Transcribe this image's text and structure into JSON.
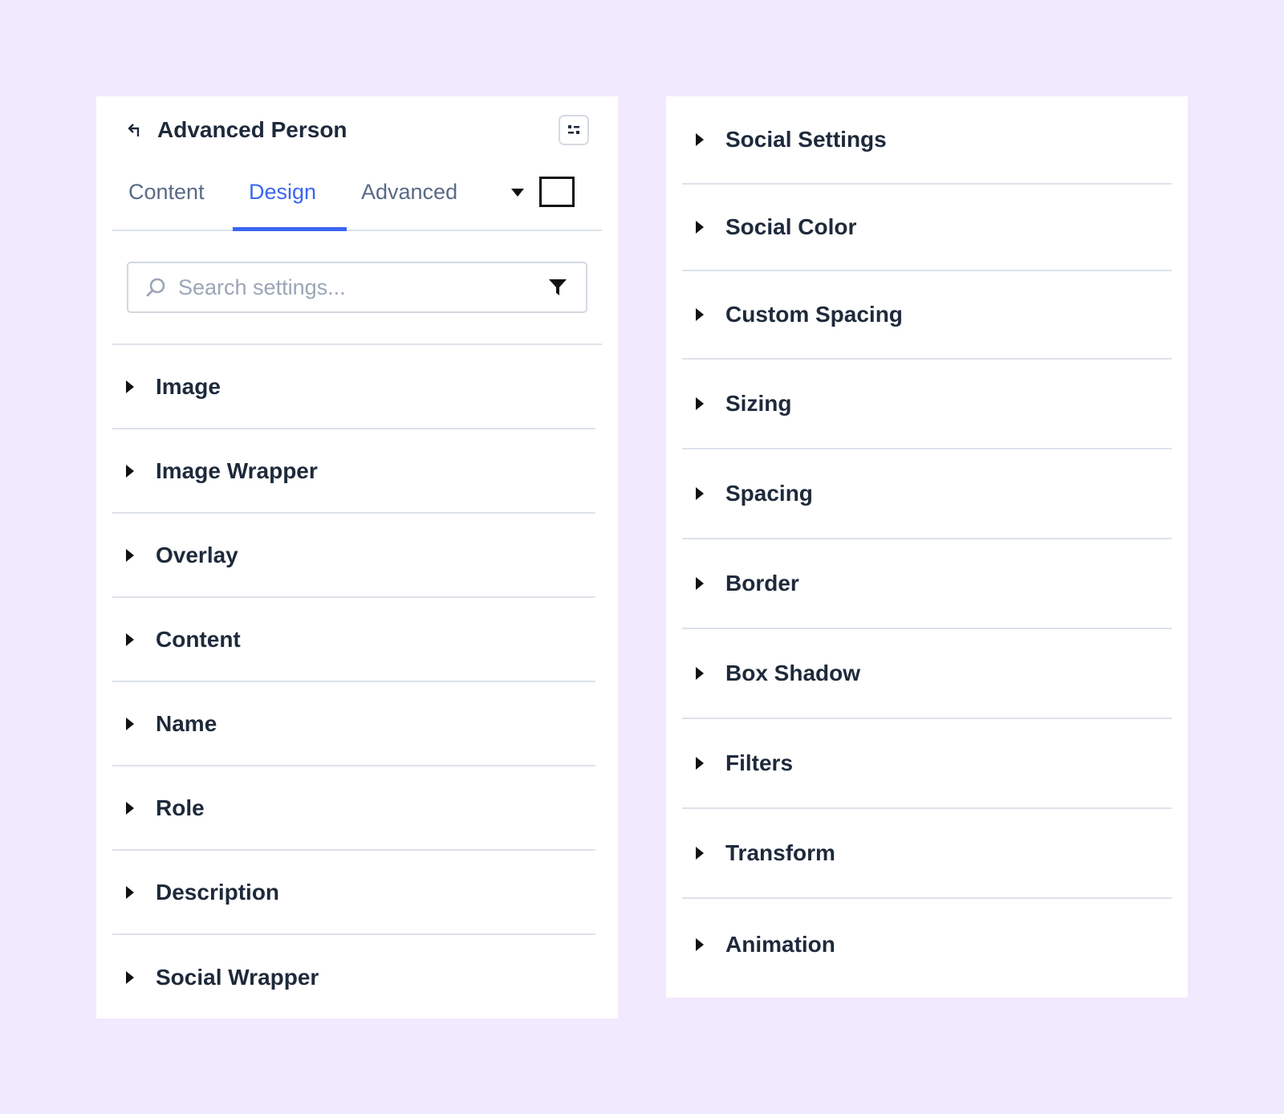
{
  "header": {
    "title": "Advanced Person",
    "back_icon": "back-arrow-icon",
    "collapse_icon": "collapse-panel-icon"
  },
  "tabs": [
    {
      "label": "Content",
      "active": false
    },
    {
      "label": "Design",
      "active": true
    },
    {
      "label": "Advanced",
      "active": false
    }
  ],
  "search": {
    "placeholder": "Search settings...",
    "value": ""
  },
  "left_sections": [
    {
      "label": "Image"
    },
    {
      "label": "Image Wrapper"
    },
    {
      "label": "Overlay"
    },
    {
      "label": "Content"
    },
    {
      "label": "Name"
    },
    {
      "label": "Role"
    },
    {
      "label": "Description"
    },
    {
      "label": "Social Wrapper"
    }
  ],
  "right_sections": [
    {
      "label": "Social Settings"
    },
    {
      "label": "Social Color"
    },
    {
      "label": "Custom Spacing"
    },
    {
      "label": "Sizing"
    },
    {
      "label": "Spacing"
    },
    {
      "label": "Border"
    },
    {
      "label": "Box Shadow"
    },
    {
      "label": "Filters"
    },
    {
      "label": "Transform"
    },
    {
      "label": "Animation"
    }
  ],
  "colors": {
    "background": "#f1e9fd",
    "accent": "#3b66f0",
    "text": "#1e2a3b",
    "muted": "#5a6a85"
  }
}
